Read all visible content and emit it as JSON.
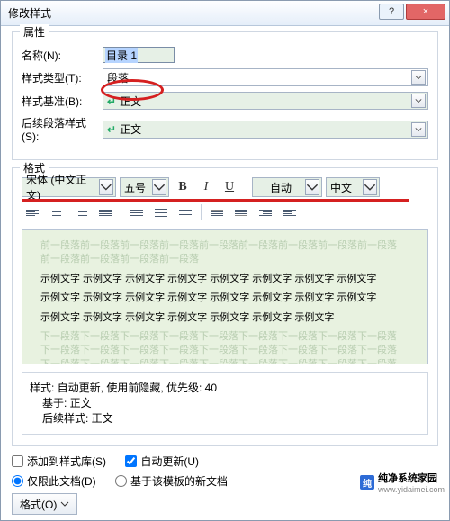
{
  "window": {
    "title": "修改样式",
    "help_icon": "?",
    "close_icon": "×"
  },
  "properties_group": {
    "legend": "属性",
    "name_label": "名称(N):",
    "name_value": "目录 1",
    "style_type_label": "样式类型(T):",
    "style_type_value": "段落",
    "style_base_label": "样式基准(B):",
    "style_base_value": "正文",
    "next_style_label": "后续段落样式(S):",
    "next_style_value": "正文"
  },
  "format_group": {
    "legend": "格式",
    "font_family": "宋体 (中文正文)",
    "font_size": "五号",
    "bold": "B",
    "italic": "I",
    "underline": "U",
    "color_label": "自动",
    "lang": "中文"
  },
  "preview": {
    "faint_prev": "前一段落前一段落前一段落前一段落前一段落前一段落前一段落前一段落前一段落",
    "faint_prev2": "前一段落前一段落前一段落前一段落",
    "sample_line": "示例文字 示例文字 示例文字 示例文字 示例文字 示例文字 示例文字 示例文字",
    "sample_line2": "示例文字 示例文字 示例文字 示例文字 示例文字 示例文字 示例文字 示例文字",
    "sample_line3": "示例文字 示例文字 示例文字 示例文字 示例文字 示例文字 示例文字",
    "faint_next": "下一段落下一段落下一段落下一段落下一段落下一段落下一段落下一段落下一段落",
    "faint_next2": "下一段落下一段落下一段落下一段落下一段落下一段落下一段落下一段落下一段落"
  },
  "description": {
    "line1": "样式: 自动更新, 使用前隐藏, 优先级: 40",
    "line2": "基于: 正文",
    "line3": "后续样式: 正文"
  },
  "bottom": {
    "add_to_gallery": "添加到样式库(S)",
    "auto_update": "自动更新(U)",
    "only_this_doc": "仅限此文档(D)",
    "based_on_template": "基于该模板的新文档",
    "format_btn": "格式(O)"
  },
  "watermark": {
    "text": "纯净系统家园",
    "url": "www.yidaimei.com"
  }
}
